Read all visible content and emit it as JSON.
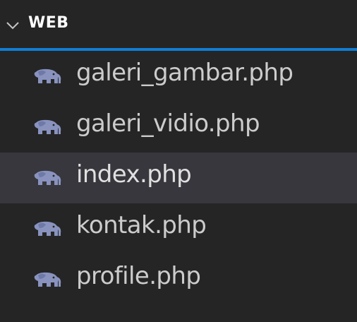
{
  "explorer": {
    "section_title": "WEB",
    "files": [
      {
        "name": "galeri_gambar.php",
        "icon": "php-elephant-icon",
        "selected": false
      },
      {
        "name": "galeri_vidio.php",
        "icon": "php-elephant-icon",
        "selected": false
      },
      {
        "name": "index.php",
        "icon": "php-elephant-icon",
        "selected": true
      },
      {
        "name": "kontak.php",
        "icon": "php-elephant-icon",
        "selected": false
      },
      {
        "name": "profile.php",
        "icon": "php-elephant-icon",
        "selected": false
      }
    ]
  },
  "colors": {
    "background": "#252526",
    "selected_row": "#37373d",
    "focus_line": "#0e7fd6",
    "php_icon": "#8993be",
    "text": "#cccccc"
  }
}
